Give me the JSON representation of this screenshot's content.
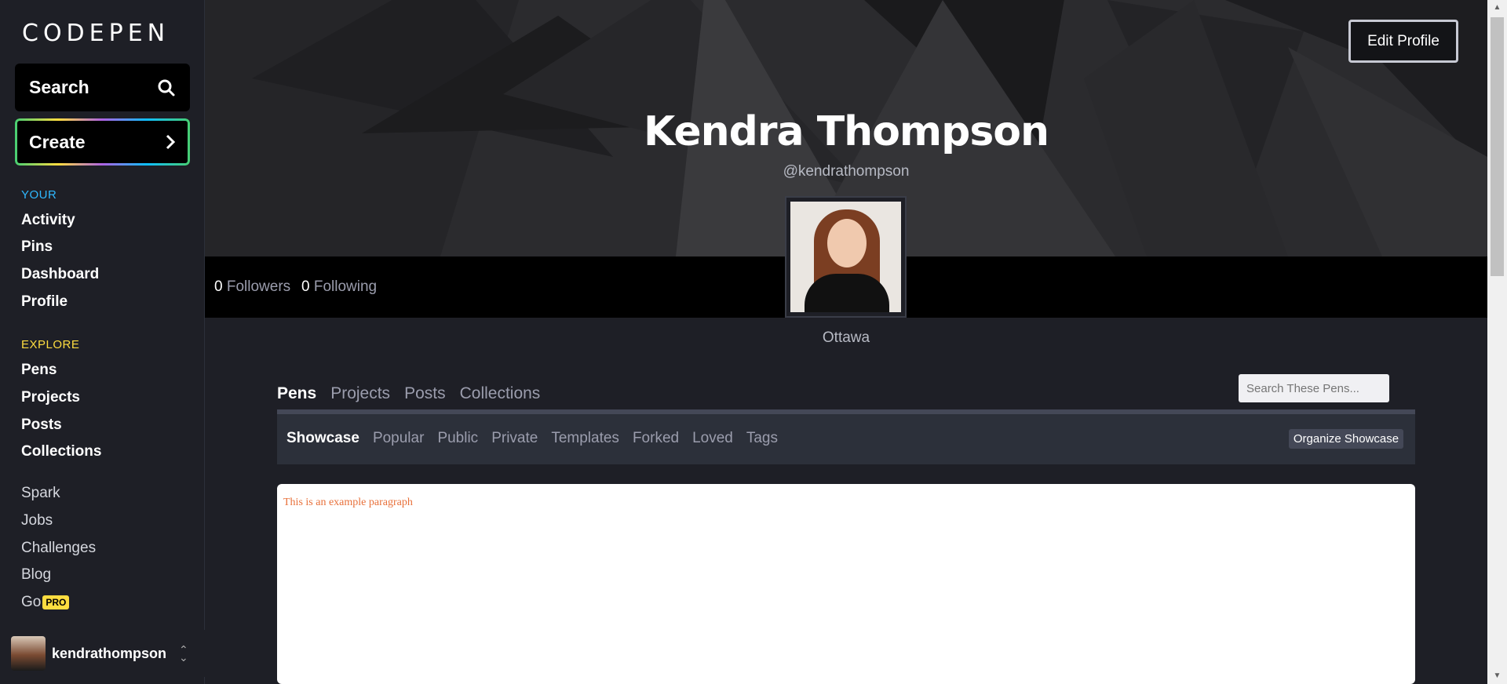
{
  "sidebar": {
    "logo_text": "CODEPEN",
    "search_label": "Search",
    "create_label": "Create",
    "your_heading": "YOUR",
    "your_items": [
      "Activity",
      "Pins",
      "Dashboard",
      "Profile"
    ],
    "explore_heading": "EXPLORE",
    "explore_items": [
      "Pens",
      "Projects",
      "Posts",
      "Collections"
    ],
    "misc_items": [
      "Spark",
      "Jobs",
      "Challenges",
      "Blog",
      "Go"
    ],
    "pro_badge": "PRO",
    "username": "kendrathompson"
  },
  "profile": {
    "edit_label": "Edit Profile",
    "name": "Kendra Thompson",
    "handle": "@kendrathompson",
    "followers_count": "0",
    "followers_label": "Followers",
    "following_count": "0",
    "following_label": "Following",
    "location": "Ottawa"
  },
  "tabs": [
    "Pens",
    "Projects",
    "Posts",
    "Collections"
  ],
  "search_placeholder": "Search These Pens...",
  "subtabs": [
    "Showcase",
    "Popular",
    "Public",
    "Private",
    "Templates",
    "Forked",
    "Loved",
    "Tags"
  ],
  "organize_label": "Organize Showcase",
  "preview_text": "This is an example paragraph",
  "colors": {
    "your_heading": "#2fb8ff",
    "explore_heading": "#ffdd40",
    "preview_text": "#e8703a"
  }
}
